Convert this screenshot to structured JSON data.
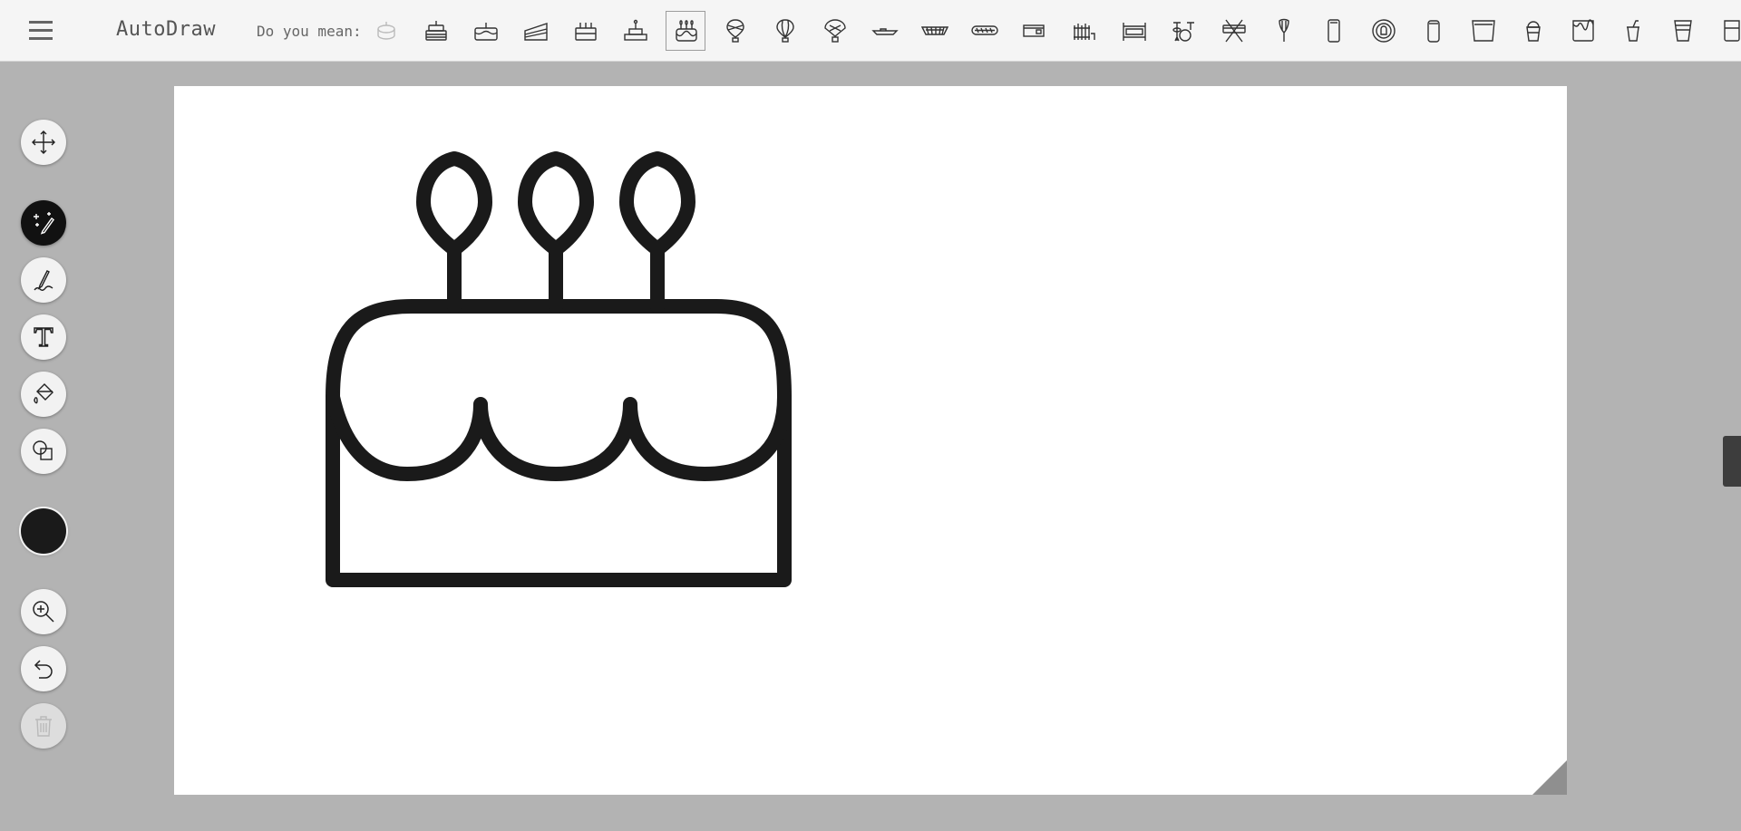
{
  "app": {
    "title": "AutoDraw"
  },
  "suggestions": {
    "label": "Do you mean:",
    "selected_index": 6,
    "items": [
      "cake-icon",
      "layered-cake-icon",
      "cake-slice-candle-icon",
      "cake-slice-icon",
      "candle-cake-icon",
      "tiered-cake-icon",
      "birthday-cake-icon",
      "hot-air-balloon-icon",
      "balloon-icon",
      "parachute-balloon-icon",
      "boat-icon",
      "bread-basket-icon",
      "hot-dog-icon",
      "radiator-icon",
      "heater-icon",
      "crib-icon",
      "drum-kit-icon",
      "drum-icon",
      "whisk-icon",
      "phone-icon",
      "ring-icon",
      "can-icon",
      "bucket-icon",
      "cup-icon",
      "paint-can-icon",
      "coffee-cup-icon",
      "glass-icon",
      "mug-icon"
    ]
  },
  "toolbar": {
    "tools": [
      {
        "name": "select-tool",
        "icon": "move-icon"
      },
      {
        "name": "autodraw-tool",
        "icon": "sparkle-pencil-icon",
        "active": true
      },
      {
        "name": "draw-tool",
        "icon": "pen-icon"
      },
      {
        "name": "type-tool",
        "icon": "text-icon"
      },
      {
        "name": "fill-tool",
        "icon": "paint-bucket-icon"
      },
      {
        "name": "shape-tool",
        "icon": "shapes-icon"
      },
      {
        "name": "zoom-tool",
        "icon": "zoom-in-icon"
      },
      {
        "name": "undo-tool",
        "icon": "undo-icon"
      },
      {
        "name": "delete-tool",
        "icon": "trash-icon",
        "disabled": true
      }
    ],
    "current_color": "#1a1a1a"
  },
  "colors": {
    "stroke": "#1a1a1a",
    "canvas": "#ffffff",
    "background": "#b3b3b3",
    "topbar": "#f5f5f5"
  }
}
